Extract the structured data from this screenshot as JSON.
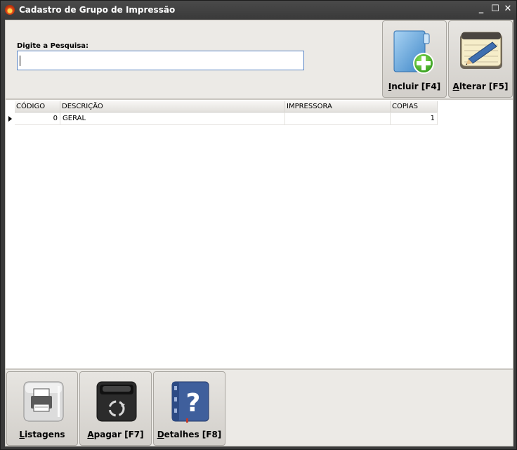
{
  "window": {
    "title": "Cadastro de Grupo de Impressão",
    "controls": {
      "minimize": "_",
      "maximize": "☐",
      "close": "✕"
    }
  },
  "search": {
    "label": "Digite a Pesquisa:",
    "value": ""
  },
  "toolbar": {
    "incluir_first": "I",
    "incluir_rest": "ncluir [F4]",
    "alterar_first": "A",
    "alterar_rest": "lterar [F5]"
  },
  "grid": {
    "columns": [
      "CÓDIGO",
      "DESCRIÇÃO",
      "IMPRESSORA",
      "COPIAS"
    ],
    "rows": [
      {
        "codigo": "0",
        "descricao": "GERAL",
        "impressora": "",
        "copias": "1"
      }
    ]
  },
  "bottom": {
    "listagens_first": "L",
    "listagens_rest": "istagens",
    "apagar_first": "A",
    "apagar_rest": "pagar [F7]",
    "detalhes_first": "D",
    "detalhes_rest": "etalhes [F8]"
  },
  "icons": {
    "incluir": "folder-add-icon",
    "alterar": "notepad-pencil-icon",
    "listagens": "printer-icon",
    "apagar": "recycle-bin-icon",
    "detalhes": "help-book-icon"
  }
}
